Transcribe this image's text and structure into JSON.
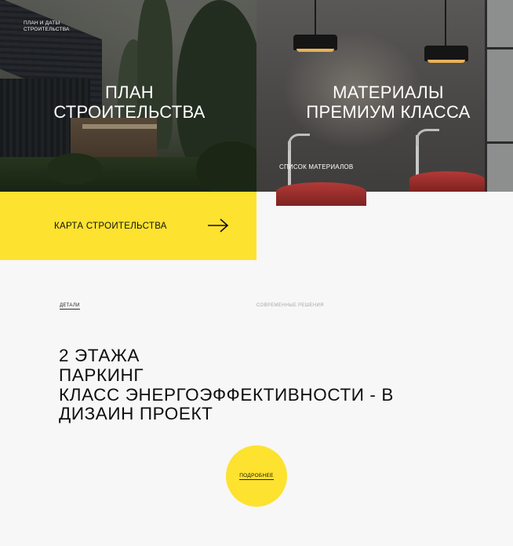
{
  "tiles": {
    "plan": {
      "caption_line1": "ПЛАН И ДАТЫ",
      "caption_line2": "СТРОИТЕЛЬСТВА",
      "title_line1": "ПЛАН",
      "title_line2": "СТРОИТЕЛЬСТВА"
    },
    "materials": {
      "title_line1": "МАТЕРИАЛЫ",
      "title_line2": "ПРЕМИУМ КЛАССА",
      "link": "СПИСОК МАТЕРИАЛОВ"
    }
  },
  "cta": {
    "label": "КАРТА СТРОИТЕЛЬСТВА",
    "icon": "arrow-right-icon",
    "color": "#fde22f"
  },
  "details": {
    "tabs": [
      "ДЕТАЛИ",
      "СОВРЕМЕННЫЕ РЕШЕНИЯ"
    ],
    "active_tab": "ДЕТАЛИ",
    "headline": [
      "2 ЭТАЖА",
      "ПАРКИНГ",
      "КЛАСС ЭНЕРГОЭФФЕКТИВНОСТИ - B",
      "ДИЗАИН ПРОЕКТ"
    ],
    "more_button": "ПОДРОБНЕЕ"
  },
  "colors": {
    "accent": "#fde22f",
    "background": "#f7f7f7",
    "text": "#111111",
    "muted": "#a8a8a8"
  }
}
